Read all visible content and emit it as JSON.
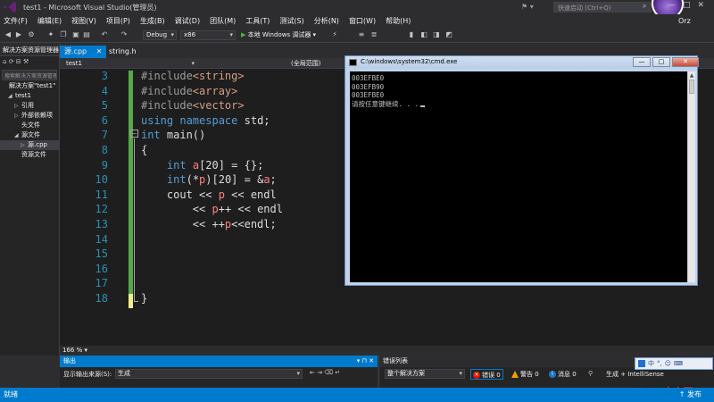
{
  "window": {
    "title": "test1 - Microsoft Visual Studio(管理员)",
    "quick_launch_placeholder": "快速启动 (Ctrl+Q)",
    "user": "Orz",
    "controls": [
      "—",
      "□",
      "✕"
    ]
  },
  "menu": [
    "文件(F)",
    "编辑(E)",
    "视图(V)",
    "项目(P)",
    "生成(B)",
    "调试(D)",
    "团队(M)",
    "工具(T)",
    "测试(S)",
    "分析(N)",
    "窗口(W)",
    "帮助(H)"
  ],
  "toolbar": {
    "config": "Debug",
    "platform": "x86",
    "run_label": "本地 Windows 调试器",
    "icons": [
      "back-icon",
      "forward-icon",
      "new-project-icon",
      "open-icon",
      "save-icon",
      "save-all-icon",
      "undo-icon",
      "redo-icon"
    ]
  },
  "solution_explorer": {
    "header": "解决方案资源管理器",
    "search_placeholder": "搜索解决方案资源管理器",
    "tree": [
      {
        "label": "解决方案\"test1\"",
        "indent": 0,
        "toggle": ""
      },
      {
        "label": "test1",
        "indent": 1,
        "toggle": "◢"
      },
      {
        "label": "引用",
        "indent": 2,
        "toggle": "▷"
      },
      {
        "label": "外部依赖项",
        "indent": 2,
        "toggle": "▷"
      },
      {
        "label": "头文件",
        "indent": 2,
        "toggle": ""
      },
      {
        "label": "源文件",
        "indent": 2,
        "toggle": "◢"
      },
      {
        "label": "源.cpp",
        "indent": 3,
        "toggle": "▷"
      },
      {
        "label": "资源文件",
        "indent": 2,
        "toggle": ""
      }
    ]
  },
  "tabs": [
    {
      "label": "源.cpp",
      "active": true,
      "close": "✕"
    },
    {
      "label": "string.h",
      "active": false,
      "close": ""
    }
  ],
  "nav": {
    "project": "test1",
    "scope": "(全局范围)"
  },
  "code": [
    {
      "n": "3",
      "segs": [
        [
          "pp",
          "#include"
        ],
        [
          "str",
          "<string>"
        ]
      ]
    },
    {
      "n": "4",
      "segs": [
        [
          "pp",
          "#include"
        ],
        [
          "str",
          "<array>"
        ]
      ]
    },
    {
      "n": "5",
      "segs": [
        [
          "pp",
          "#include"
        ],
        [
          "str",
          "<vector>"
        ]
      ]
    },
    {
      "n": "6",
      "segs": [
        [
          "kw",
          "using"
        ],
        [
          "plain",
          " "
        ],
        [
          "kw",
          "namespace"
        ],
        [
          "plain",
          " std;"
        ]
      ]
    },
    {
      "n": "7",
      "segs": [
        [
          "kw",
          "int"
        ],
        [
          "plain",
          " main()"
        ]
      ]
    },
    {
      "n": "8",
      "segs": [
        [
          "plain",
          "{"
        ]
      ]
    },
    {
      "n": "9",
      "segs": [
        [
          "plain",
          "    "
        ],
        [
          "kw",
          "int"
        ],
        [
          "plain",
          " "
        ],
        [
          "var",
          "a"
        ],
        [
          "plain",
          "[20] = {};"
        ]
      ]
    },
    {
      "n": "10",
      "segs": [
        [
          "plain",
          "    "
        ],
        [
          "kw",
          "int"
        ],
        [
          "plain",
          "(*"
        ],
        [
          "var",
          "p"
        ],
        [
          "plain",
          ")[20] = &"
        ],
        [
          "var",
          "a"
        ],
        [
          "plain",
          ";"
        ]
      ]
    },
    {
      "n": "11",
      "segs": [
        [
          "plain",
          "    cout << "
        ],
        [
          "var",
          "p"
        ],
        [
          "plain",
          " << endl"
        ]
      ]
    },
    {
      "n": "12",
      "segs": [
        [
          "plain",
          "        << "
        ],
        [
          "var",
          "p"
        ],
        [
          "plain",
          "++ << endl"
        ]
      ]
    },
    {
      "n": "13",
      "segs": [
        [
          "plain",
          "        << ++"
        ],
        [
          "var",
          "p"
        ],
        [
          "plain",
          "<<endl;"
        ]
      ]
    },
    {
      "n": "14",
      "segs": []
    },
    {
      "n": "15",
      "segs": []
    },
    {
      "n": "16",
      "segs": []
    },
    {
      "n": "17",
      "segs": []
    },
    {
      "n": "18",
      "segs": [
        [
          "plain",
          "}"
        ]
      ]
    }
  ],
  "zoom": "166 %",
  "cmd": {
    "title": "C:\\windows\\system32\\cmd.exe",
    "lines": [
      "003EFBE0",
      "003EFB90",
      "003EFBE0",
      "请按任意键继续. . ."
    ]
  },
  "output": {
    "header": "输出",
    "source_label": "显示输出来源(S):",
    "source_value": "生成"
  },
  "error_list": {
    "header": "错误列表",
    "scope": "整个解决方案",
    "errors": "错误 0",
    "warnings": "警告 0",
    "messages": "消息 0",
    "build": "生成 + IntelliSense"
  },
  "ime": [
    "中",
    "°,",
    "☺",
    "⌨"
  ],
  "status": {
    "left": "就绪",
    "right": "发布"
  },
  "colors": {
    "accent": "#007acc",
    "keyword": "#569cd6",
    "string": "#d69d85",
    "variable": "#ff8080",
    "line_number": "#2b91af"
  }
}
